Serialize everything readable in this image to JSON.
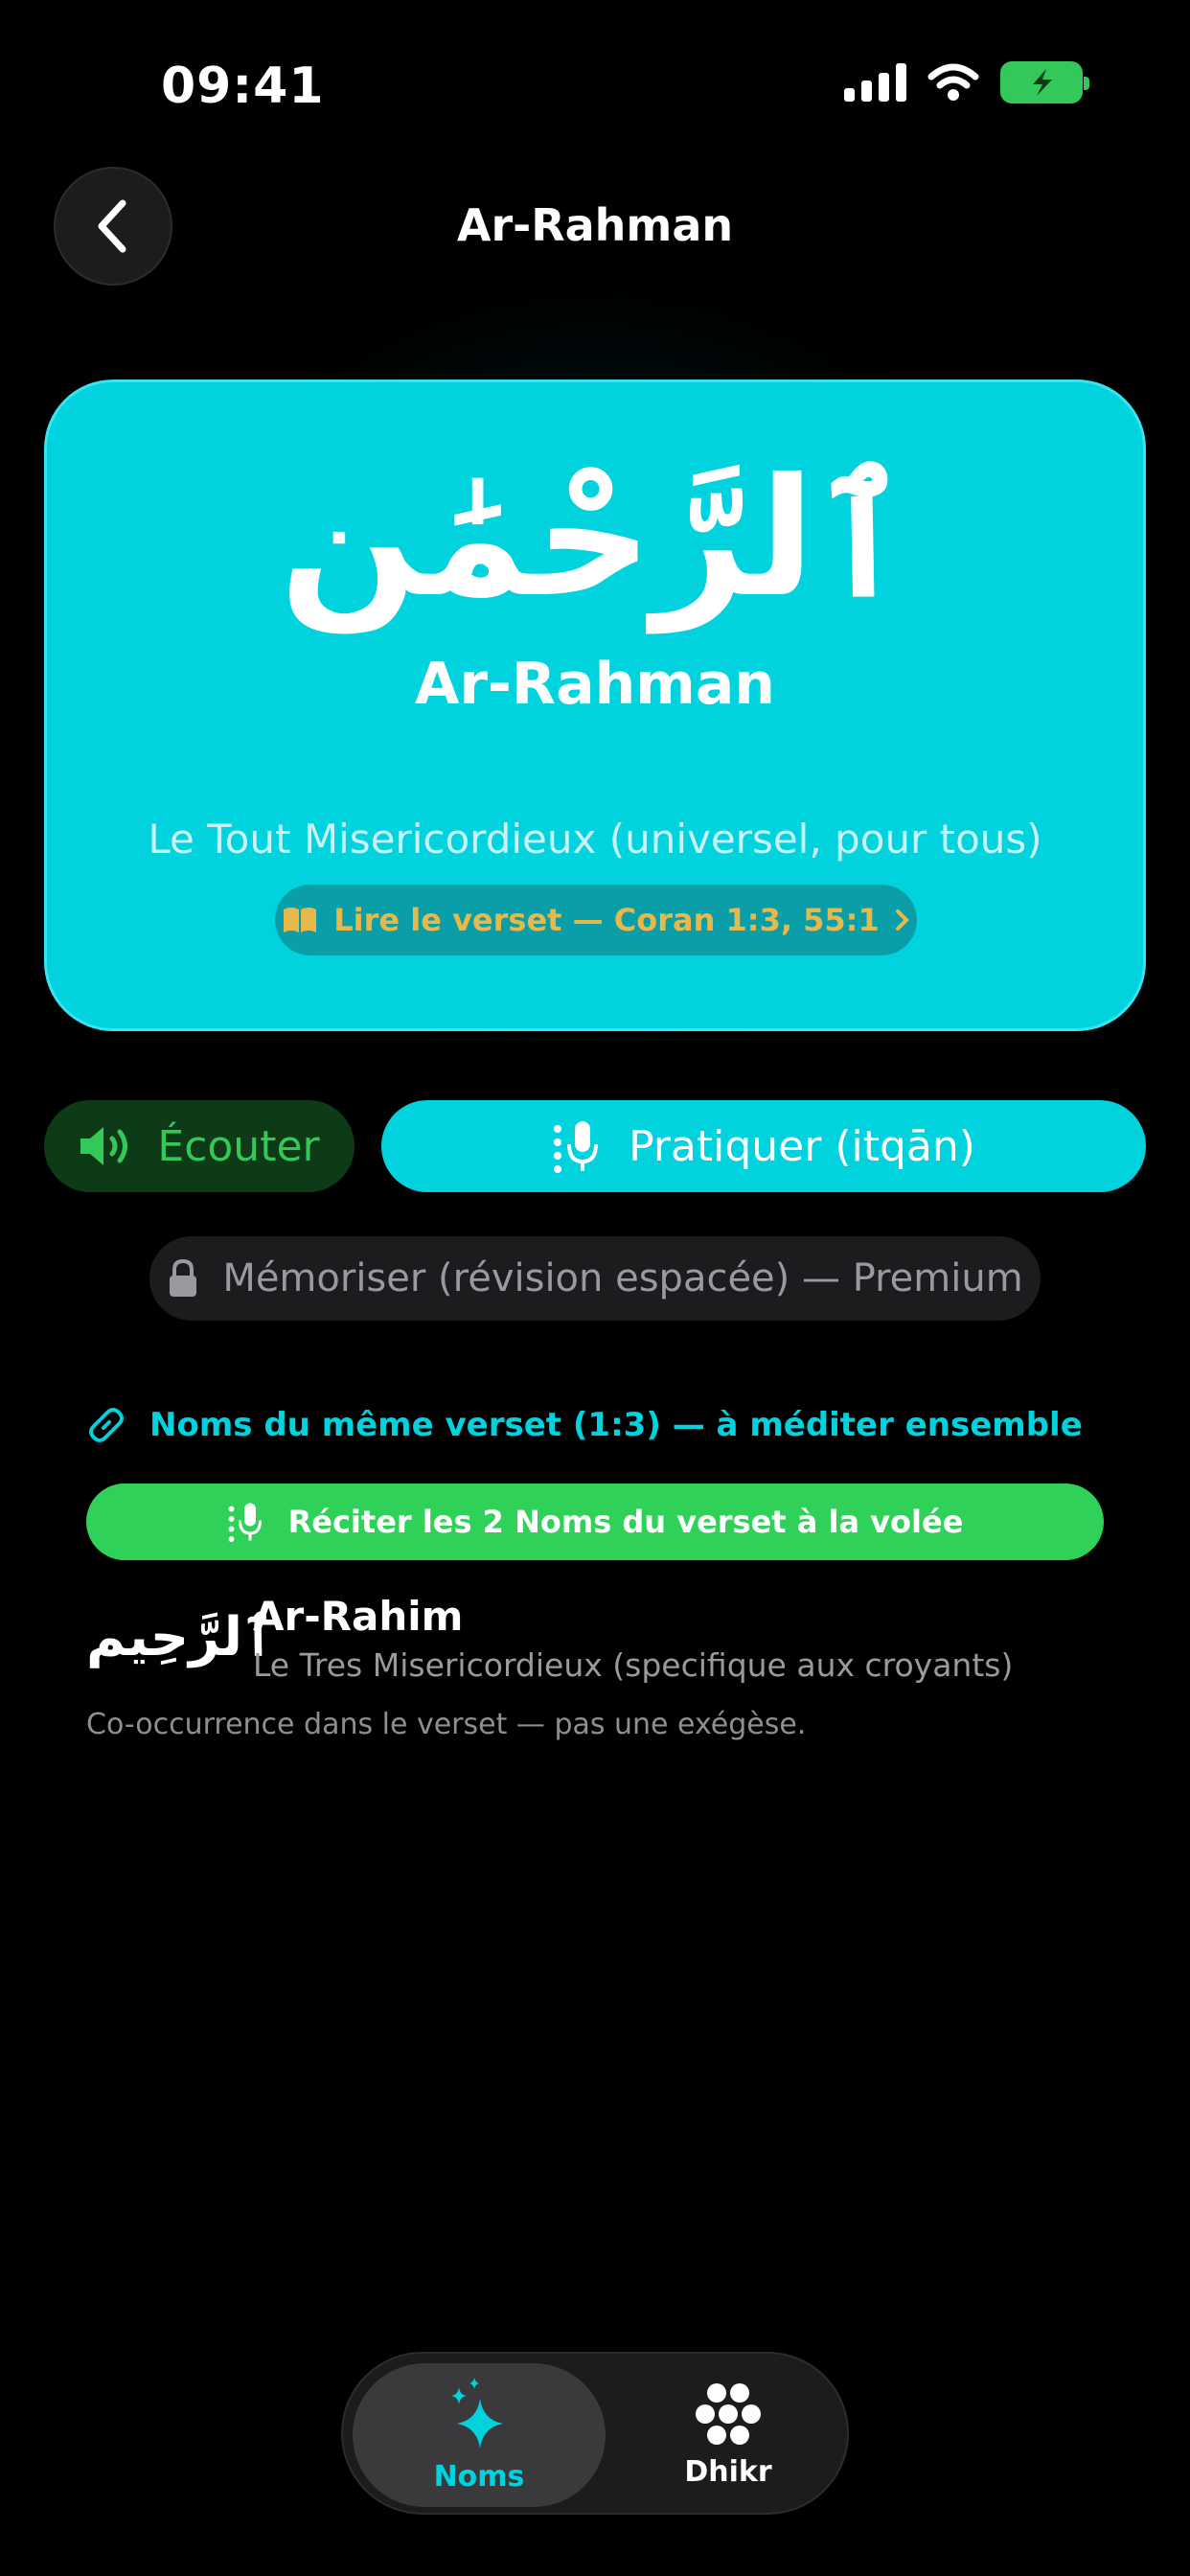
{
  "status": {
    "time": "09:41"
  },
  "header": {
    "title": "Ar-Rahman"
  },
  "hero": {
    "arabic": "ٱلرَّحْمَٰن",
    "name": "Ar-Rahman",
    "meaning": "Le Tout Misericordieux (universel, pour tous)",
    "verse_link": "Lire le verset — Coran 1:3, 55:1"
  },
  "actions": {
    "listen": "Écouter",
    "practice": "Pratiquer (itqān)",
    "memorize": "Mémoriser (révision espacée) — Premium"
  },
  "related": {
    "heading": "Noms du même verset (1:3) — à méditer ensemble",
    "recite_button": "Réciter les 2 Noms du verset à la volée",
    "item": {
      "arabic": "ٱلرَّحِيم",
      "name": "Ar-Rahim",
      "meaning": "Le Tres Misericordieux (specifique aux croyants)"
    },
    "disclaimer": "Co-occurrence dans le verset — pas une exégèse."
  },
  "tabs": [
    {
      "label": "Noms"
    },
    {
      "label": "Dhikr"
    }
  ],
  "colors": {
    "accent": "#00d2de",
    "green": "#34c759",
    "gold": "#e8b84a"
  }
}
